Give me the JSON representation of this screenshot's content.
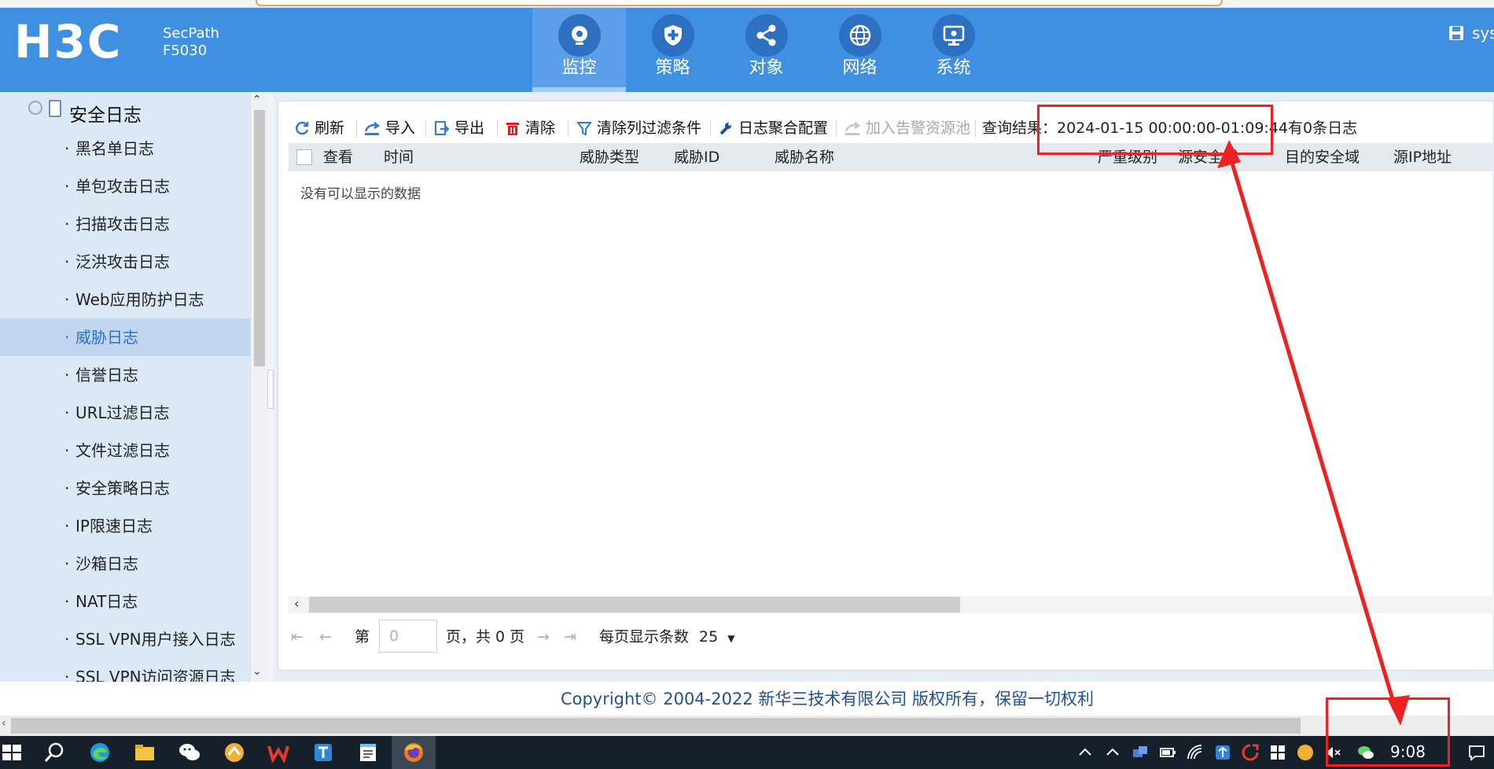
{
  "header": {
    "logo": "H3C",
    "model_line1": "SecPath",
    "model_line2": "F5030",
    "user": "sys",
    "nav": [
      {
        "label": "监控",
        "icon": "monitor-eye-icon",
        "active": true
      },
      {
        "label": "策略",
        "icon": "shield-plus-icon",
        "active": false
      },
      {
        "label": "对象",
        "icon": "share-nodes-icon",
        "active": false
      },
      {
        "label": "网络",
        "icon": "globe-icon",
        "active": false
      },
      {
        "label": "系统",
        "icon": "system-screen-icon",
        "active": false
      }
    ]
  },
  "sidebar": {
    "section_title": "安全日志",
    "items": [
      {
        "label": "黑名单日志"
      },
      {
        "label": "单包攻击日志"
      },
      {
        "label": "扫描攻击日志"
      },
      {
        "label": "泛洪攻击日志"
      },
      {
        "label": "Web应用防护日志"
      },
      {
        "label": "威胁日志",
        "active": true
      },
      {
        "label": "信誉日志"
      },
      {
        "label": "URL过滤日志"
      },
      {
        "label": "文件过滤日志"
      },
      {
        "label": "安全策略日志"
      },
      {
        "label": "IP限速日志"
      },
      {
        "label": "沙箱日志"
      },
      {
        "label": "NAT日志"
      },
      {
        "label": "SSL VPN用户接入日志"
      },
      {
        "label": "SSL VPN访问资源日志"
      }
    ]
  },
  "toolbar": {
    "refresh": "刷新",
    "import": "导入",
    "export": "导出",
    "clear": "清除",
    "clear_filter": "清除列过滤条件",
    "aggregation": "日志聚合配置",
    "add_alarm_pool": "加入告警资源池",
    "query_result": "查询结果：2024-01-15 00:00:00-01:09:44有0条日志"
  },
  "table": {
    "columns": [
      "查看",
      "时间",
      "威胁类型",
      "威胁ID",
      "威胁名称",
      "严重级别",
      "源安全域",
      "目的安全域",
      "源IP地址"
    ],
    "empty_text": "没有可以显示的数据"
  },
  "pagination": {
    "page_prefix": "第",
    "page_value": "0",
    "page_suffix": "页，共 0 页",
    "per_page_label": "每页显示条数",
    "per_page_value": "25"
  },
  "footer": {
    "copyright": "Copyright© 2004-2022 新华三技术有限公司 版权所有，保留一切权利"
  },
  "taskbar": {
    "time": "9:08"
  },
  "colors": {
    "header": "#3f8fe3",
    "accent": "#2b6fd0",
    "annotation": "#ef2020"
  }
}
